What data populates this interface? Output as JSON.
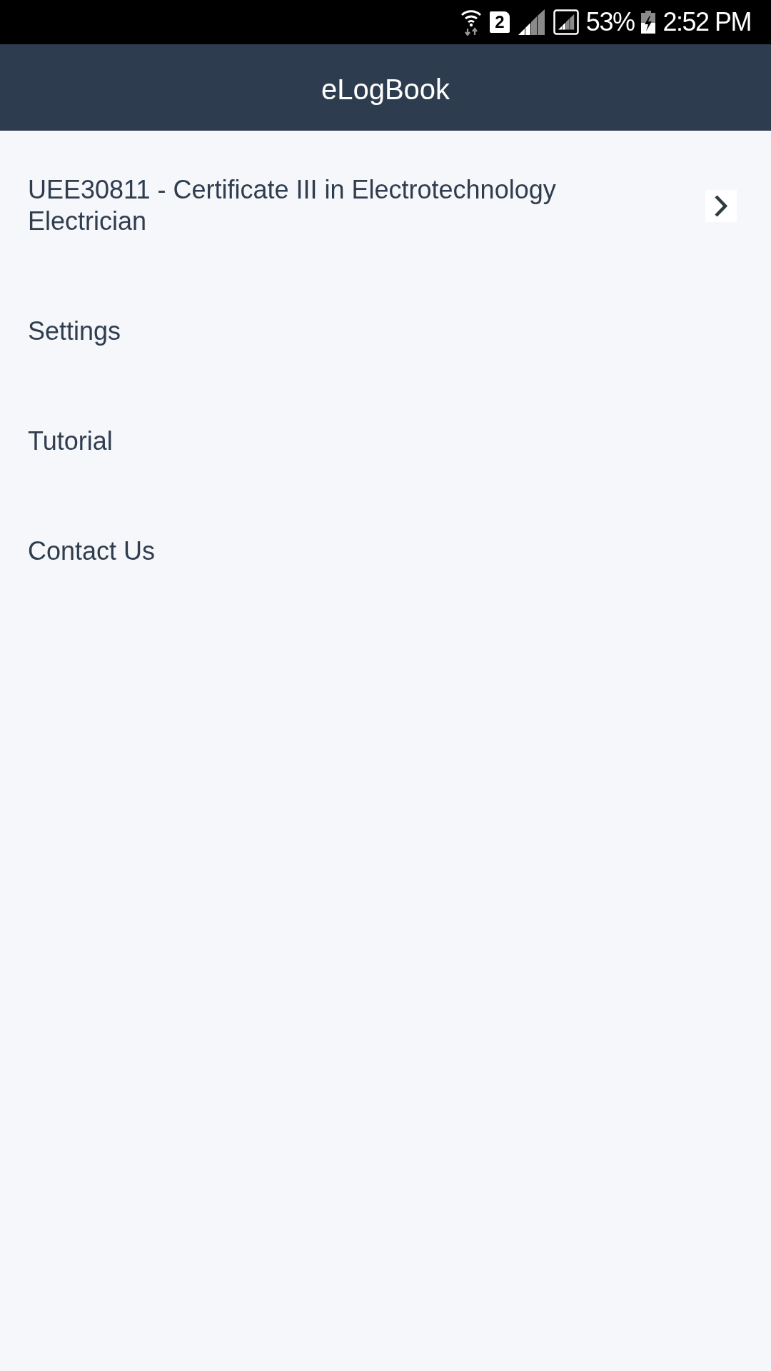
{
  "status_bar": {
    "sim_label": "2",
    "battery_percent": "53%",
    "charging": true,
    "time": "2:52 PM"
  },
  "app_bar": {
    "title": "eLogBook"
  },
  "menu": [
    {
      "kind": "course",
      "label": "UEE30811 - Certificate III in Electrotechnology Electrician"
    },
    {
      "kind": "plain",
      "label": "Settings"
    },
    {
      "kind": "plain",
      "label": "Tutorial"
    },
    {
      "kind": "plain",
      "label": "Contact Us"
    }
  ]
}
